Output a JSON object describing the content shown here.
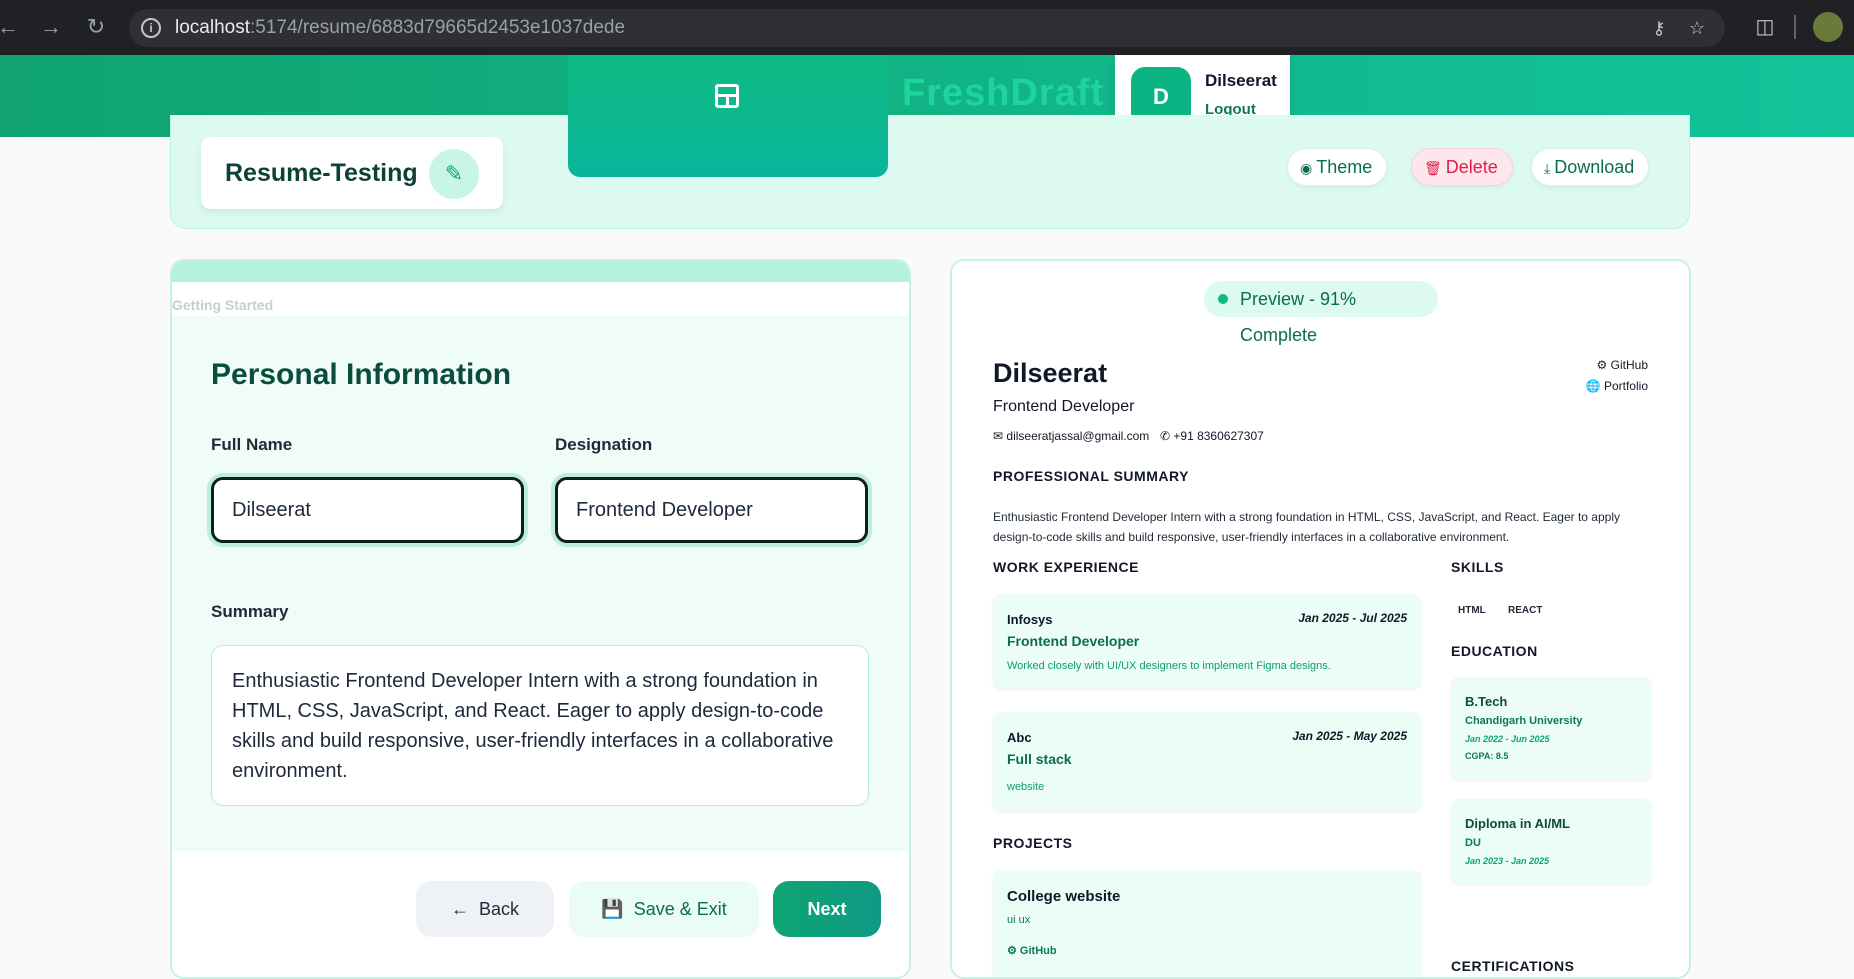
{
  "browser": {
    "url_host": "localhost",
    "url_rest": ":5174/resume/6883d79665d2453e1037dede"
  },
  "header": {
    "brand": "FreshDraft",
    "user_initial": "D",
    "user_name": "Dilseerat",
    "logout_label": "Logout"
  },
  "toolbar": {
    "resume_title": "Resume-Testing",
    "theme_label": "Theme",
    "delete_label": "Delete",
    "download_label": "Download"
  },
  "form": {
    "progress_fraction": 1.0,
    "step_label": "Getting Started",
    "section_title": "Personal Information",
    "full_name_label": "Full Name",
    "full_name_value": "Dilseerat",
    "designation_label": "Designation",
    "designation_value": "Frontend Developer",
    "summary_label": "Summary",
    "summary_value": "Enthusiastic Frontend Developer Intern with a strong foundation in HTML, CSS, JavaScript, and React. Eager to apply design-to-code skills and build responsive, user-friendly interfaces in a collaborative environment.",
    "back_label": "Back",
    "save_label": "Save & Exit",
    "next_label": "Next"
  },
  "preview": {
    "badge": "Preview - 91% Complete",
    "name": "Dilseerat",
    "role": "Frontend Developer",
    "email": "dilseeratjassal@gmail.com",
    "phone": "+91 8360627307",
    "github": "GitHub",
    "portfolio": "Portfolio",
    "summary_heading": "PROFESSIONAL SUMMARY",
    "summary": "Enthusiastic Frontend Developer Intern with a strong foundation in HTML, CSS, JavaScript, and React. Eager to apply design-to-code skills and build responsive, user-friendly interfaces in a collaborative environment.",
    "work_heading": "WORK EXPERIENCE",
    "work": [
      {
        "company": "Infosys",
        "dates": "Jan 2025 - Jul 2025",
        "role": "Frontend Developer",
        "desc": "Worked closely with UI/UX designers to implement Figma designs."
      },
      {
        "company": "Abc",
        "dates": "Jan 2025 - May 2025",
        "role": "Full stack",
        "desc": "website"
      }
    ],
    "projects_heading": "PROJECTS",
    "projects": [
      {
        "title": "College website",
        "desc": "ui ux",
        "link": "GitHub"
      }
    ],
    "skills_heading": "SKILLS",
    "skills": [
      "HTML",
      "REACT"
    ],
    "education_heading": "EDUCATION",
    "education": [
      {
        "degree": "B.Tech",
        "institute": "Chandigarh University",
        "dates": "Jan 2022 - Jun 2025",
        "cgpa": "CGPA: 8.5"
      },
      {
        "degree": "Diploma in AI/ML",
        "institute": "DU",
        "dates": "Jan 2023 - Jan 2025"
      }
    ],
    "certifications_heading": "CERTIFICATIONS"
  }
}
